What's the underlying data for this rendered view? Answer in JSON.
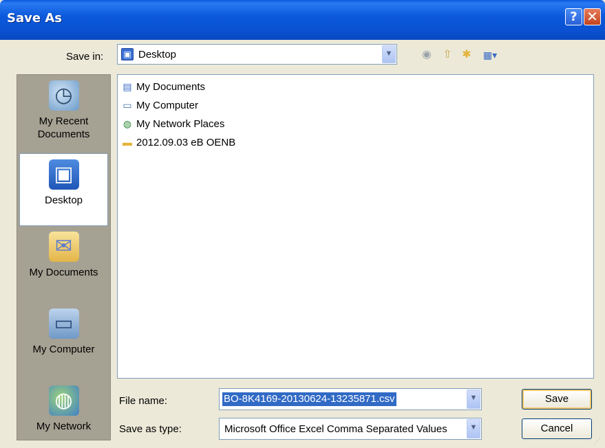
{
  "window": {
    "title": "Save As",
    "help_label": "?",
    "close_label": "✕"
  },
  "save_in": {
    "label": "Save in:",
    "value": "Desktop"
  },
  "places": [
    {
      "label": "My Recent Documents",
      "icon": "recent-documents-icon"
    },
    {
      "label": "Desktop",
      "icon": "desktop-icon",
      "selected": true
    },
    {
      "label": "My Documents",
      "icon": "my-documents-icon"
    },
    {
      "label": "My Computer",
      "icon": "my-computer-icon"
    },
    {
      "label": "My Network",
      "icon": "network-icon"
    }
  ],
  "files": [
    {
      "name": "My Documents",
      "icon": "my-documents-icon"
    },
    {
      "name": "My Computer",
      "icon": "my-computer-icon"
    },
    {
      "name": "My Network Places",
      "icon": "network-places-icon"
    },
    {
      "name": "2012.09.03 eB OENB",
      "icon": "folder-icon"
    }
  ],
  "file_name": {
    "label": "File name:",
    "value": "BO-8K4169-20130624-13235871.csv"
  },
  "save_as_type": {
    "label": "Save as type:",
    "value": "Microsoft Office Excel Comma Separated Values"
  },
  "buttons": {
    "save": "Save",
    "cancel": "Cancel"
  },
  "colors": {
    "titlebar": "#0a5ae0",
    "dialog_bg": "#ece9d8",
    "selection": "#316ac5"
  }
}
